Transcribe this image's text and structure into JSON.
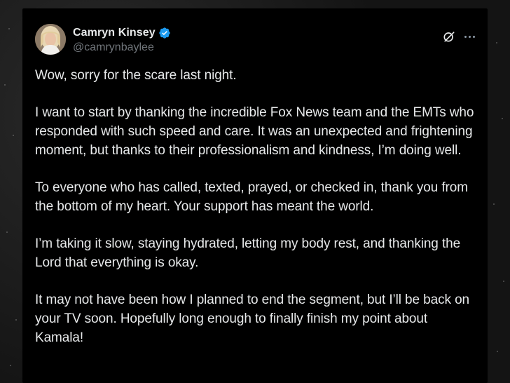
{
  "tweet": {
    "author": {
      "display_name": "Camryn Kinsey",
      "handle": "@camrynbaylee",
      "verified": true,
      "verified_color": "#1d9bf0"
    },
    "icons": {
      "grok": "grok-icon",
      "more": "more-options-icon"
    },
    "paragraphs": [
      "Wow, sorry for the scare last night.",
      "I want to start by thanking the incredible Fox News team and the EMTs who responded with such speed and care. It was an unexpected and frightening moment, but thanks to their professionalism and kindness, I’m doing well.",
      "To everyone who has called, texted, prayed, or checked in, thank you from the bottom of my heart. Your support has meant the world.",
      "I’m taking it slow, staying hydrated, letting my body rest, and thanking the Lord that everything is okay.",
      "It may not have been how I planned to end the segment, but I’ll be back on your TV soon. Hopefully long enough to finally finish my point about Kamala!"
    ]
  },
  "colors": {
    "card_background": "#000000",
    "text_primary": "#e7e9ea",
    "text_secondary": "#71767b"
  }
}
